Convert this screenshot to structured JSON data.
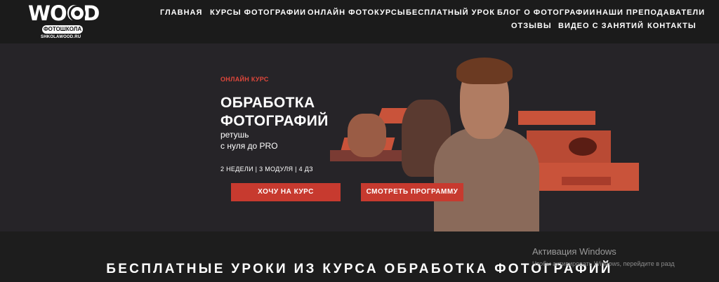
{
  "logo": {
    "brand": "WOOD",
    "school": "ФОТОШКОЛА",
    "site": "SHKOLAWOOD.RU"
  },
  "nav": {
    "items": [
      "ГЛАВНАЯ",
      "КУРСЫ ФОТОГРАФИИ",
      "ОНЛАЙН ФОТОКУРСЫ",
      "БЕСПЛАТНЫЙ УРОК",
      "БЛОГ О ФОТОГРАФИИ",
      "НАШИ ПРЕПОДАВАТЕЛИ",
      "ОТЗЫВЫ",
      "ВИДЕО С ЗАНЯТИЙ",
      "КОНТАКТЫ"
    ]
  },
  "hero": {
    "kicker": "ОНЛАЙН КУРС",
    "title_line1": "ОБРАБОТКА",
    "title_line2": "ФОТОГРАФИЙ",
    "subtitle_line1": "ретушь",
    "subtitle_line2": "с нуля до PRO",
    "meta": "2 НЕДЕЛИ | 3 МОДУЛЯ | 4 ДЗ",
    "primary_button": "ХОЧУ НА КУРС",
    "secondary_button": "СМОТРЕТЬ ПРОГРАММУ"
  },
  "section": {
    "title": "БЕСПЛАТНЫЕ УРОКИ ИЗ КУРСА ОБРАБОТКА ФОТОГРАФИЙ"
  },
  "activation": {
    "title": "Активация Windows",
    "text": "Чтобы активировать Windows, перейдите в разд"
  },
  "colors": {
    "accent": "#c73a2f",
    "stripe": "#c9533a",
    "header_bg": "#1b1b1b",
    "hero_bg": "#262428"
  }
}
